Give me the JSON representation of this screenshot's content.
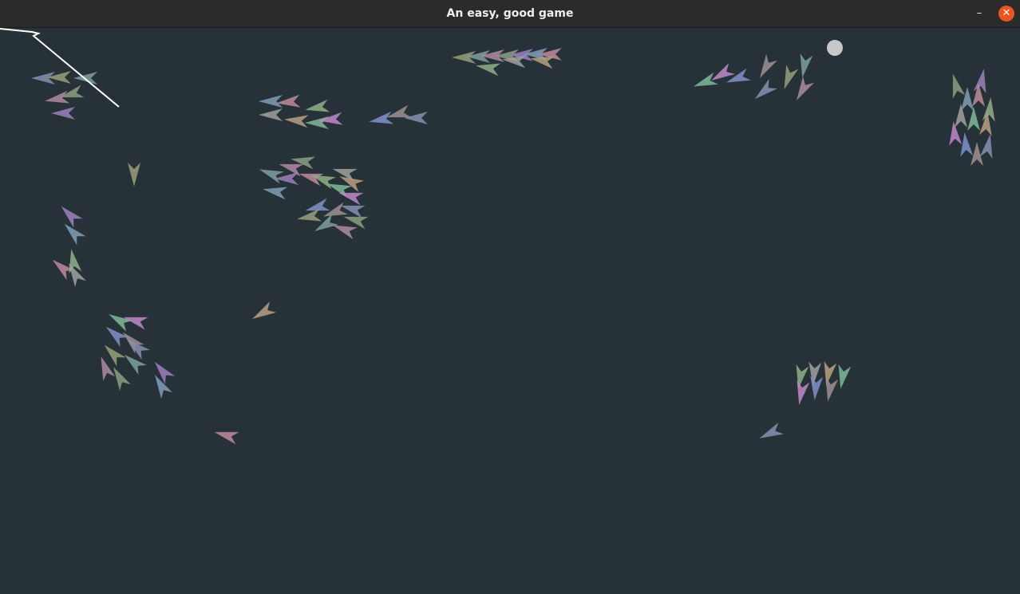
{
  "window": {
    "title": "An easy, good game",
    "minimize_glyph": "–",
    "close_glyph": "✕",
    "close_color": "#e95420"
  },
  "game": {
    "background": "#263238",
    "ball_color": "#c8c8c8",
    "trail_color": "#ffffff",
    "boid_colors": [
      "#8a8fb0",
      "#9aa07a",
      "#7fa0a0",
      "#b08aa0",
      "#8aa080",
      "#a07fc0",
      "#7f9fb8",
      "#c08a9a",
      "#8fb08a",
      "#a0a0a0",
      "#b8a080",
      "#7fb89a",
      "#c08ac8",
      "#8090c8",
      "#a09090"
    ]
  }
}
